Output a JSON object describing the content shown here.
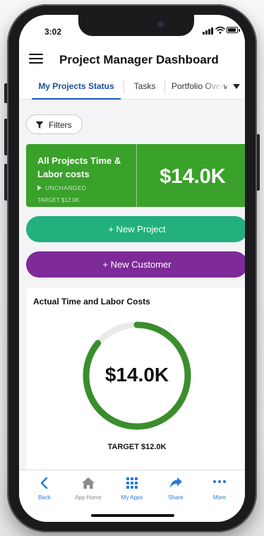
{
  "status_bar": {
    "time": "3:02"
  },
  "header": {
    "title": "Project Manager Dashboard"
  },
  "tabs": [
    {
      "label": "My Projects Status",
      "active": true
    },
    {
      "label": "Tasks",
      "active": false
    },
    {
      "label": "Portfolio Overview",
      "active": false
    }
  ],
  "filters": {
    "label": "Filters"
  },
  "kpi": {
    "title": "All Projects Time & Labor costs",
    "change": "UNCHANGED",
    "target": "TARGET $12.0K",
    "value": "$14.0K",
    "color": "#3aa12a"
  },
  "actions": {
    "new_project": "+ New Project",
    "new_customer": "+ New Customer",
    "project_color": "#22b07d",
    "customer_color": "#7e2a98"
  },
  "gauge_card": {
    "title": "Actual Time and Labor Costs",
    "value": "$14.0K",
    "target": "TARGET $12.0K",
    "fill_fraction": 0.86,
    "arc_color": "#3b8e2c",
    "track_color": "#e9ebe8"
  },
  "bottom_nav": [
    {
      "label": "Back",
      "icon": "chevron-left-icon",
      "active": true
    },
    {
      "label": "App Home",
      "icon": "home-icon",
      "active": false
    },
    {
      "label": "My Apps",
      "icon": "grid-icon",
      "active": true
    },
    {
      "label": "Share",
      "icon": "share-icon",
      "active": true
    },
    {
      "label": "More",
      "icon": "more-dots-icon",
      "active": true
    }
  ]
}
